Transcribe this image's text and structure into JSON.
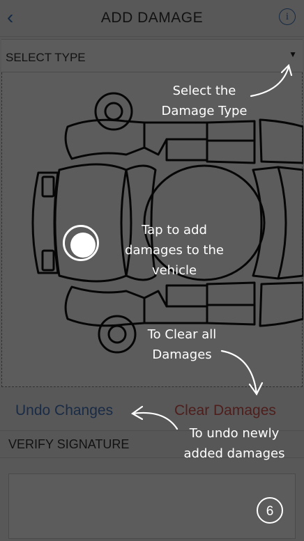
{
  "header": {
    "title": "ADD DAMAGE",
    "back_icon": "chevron-left-icon",
    "info_icon": "info-icon"
  },
  "select": {
    "label": "SELECT TYPE",
    "caret": "▼"
  },
  "actions": {
    "undo_label": "Undo Changes",
    "clear_label": "Clear Damages"
  },
  "verify": {
    "label": "VERIFY SIGNATURE"
  },
  "tutorial": {
    "select_note": "Select the Damage Type",
    "tap_note": "Tap to add damages to the vehicle",
    "clear_note": "To Clear all Damages",
    "undo_note": "To undo newly added damages",
    "step": "6"
  },
  "colors": {
    "accent": "#3b73b9",
    "undo": "#4a78c2",
    "clear": "#d9534f",
    "overlay": "rgba(0,0,0,0.64)"
  }
}
